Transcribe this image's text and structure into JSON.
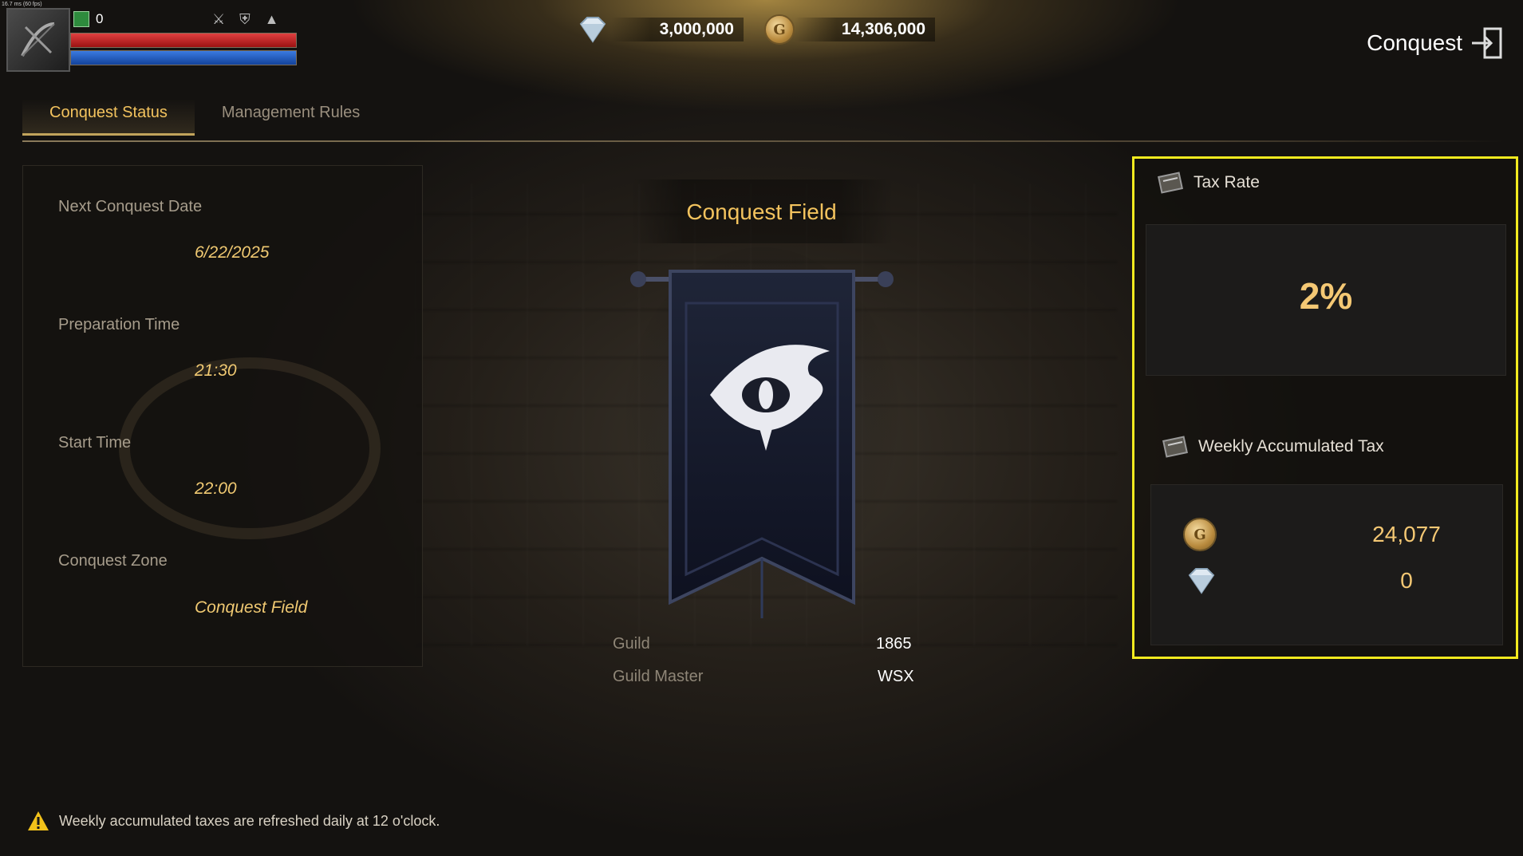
{
  "hud": {
    "fps_text": "16.7 ms (60 fps)",
    "item_count": "0"
  },
  "currency": {
    "diamond_amount": "3,000,000",
    "gold_amount": "14,306,000"
  },
  "header": {
    "title": "Conquest",
    "coin_letter": "G"
  },
  "tabs": [
    {
      "label": "Conquest Status",
      "active": true
    },
    {
      "label": "Management Rules",
      "active": false
    }
  ],
  "schedule": {
    "next_date_label": "Next Conquest Date",
    "next_date_value": "6/22/2025",
    "prep_label": "Preparation Time",
    "prep_value": "21:30",
    "start_label": "Start Time",
    "start_value": "22:00",
    "zone_label": "Conquest Zone",
    "zone_value": "Conquest Field"
  },
  "field": {
    "title": "Conquest Field",
    "guild_label": "Guild",
    "guild_value": "1865",
    "master_label": "Guild Master",
    "master_value": "WSX"
  },
  "tax": {
    "rate_label": "Tax Rate",
    "rate_value": "2%",
    "weekly_label": "Weekly Accumulated Tax",
    "gold_value": "24,077",
    "diamond_value": "0"
  },
  "notice": {
    "text": "Weekly accumulated taxes are refreshed daily at 12 o'clock."
  },
  "colors": {
    "accent_gold": "#f3c35e",
    "highlight_border": "#f2ea1f",
    "hp_red": "#c72424",
    "mp_blue": "#1f5fc4"
  }
}
